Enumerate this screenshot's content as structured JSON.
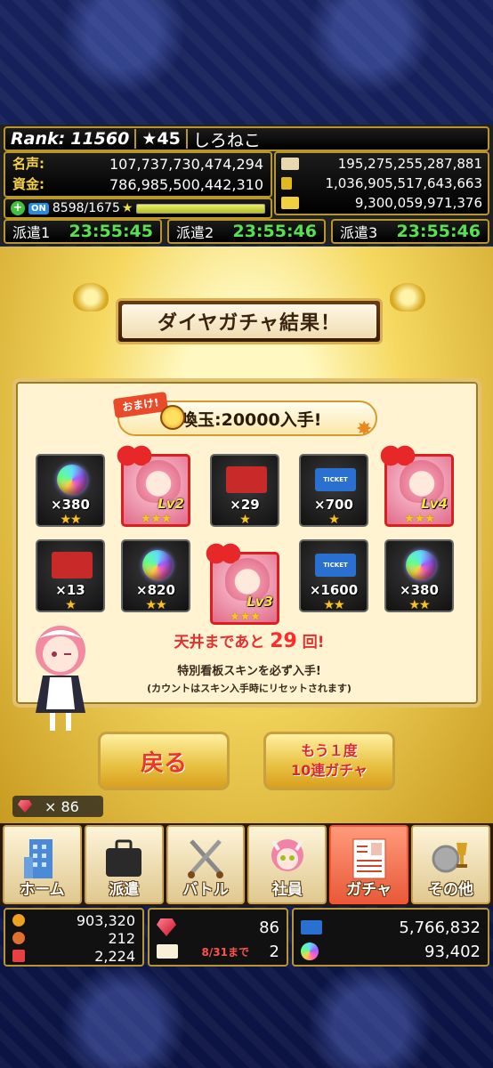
{
  "header": {
    "rank_label": "Rank:",
    "rank_value": "11560",
    "stars": "★45",
    "player_name": "しろねこ",
    "fame_label": "名声:",
    "fame_value": "107,737,730,474,294",
    "funds_label": "資金:",
    "funds_value": "786,985,500,442,310",
    "res1": "195,275,255,287,881",
    "res2": "1,036,905,517,643,663",
    "res3": "9,300,059,971,376",
    "on_label": "ON",
    "stamina": "8598/1675",
    "stamina_fill": 1.0,
    "dispatch": [
      {
        "label": "派遣1",
        "time": "23:55:45"
      },
      {
        "label": "派遣2",
        "time": "23:55:46"
      },
      {
        "label": "派遣3",
        "time": "23:55:46"
      }
    ]
  },
  "result": {
    "title": "ダイヤガチャ結果！",
    "omake_tag": "おまけ!",
    "omake_text": "召喚玉:20000入手!",
    "items": [
      {
        "type": "orb",
        "count": "×380",
        "stars": "★★"
      },
      {
        "type": "skin",
        "level": "Lv2",
        "stars": "★★★"
      },
      {
        "type": "shokan",
        "count": "×29",
        "stars": "★"
      },
      {
        "type": "ticket",
        "count": "×700",
        "stars": "★"
      },
      {
        "type": "skin",
        "level": "Lv4",
        "stars": "★★★"
      },
      {
        "type": "shokan",
        "count": "×13",
        "stars": "★"
      },
      {
        "type": "orb",
        "count": "×820",
        "stars": "★★"
      },
      {
        "type": "skin",
        "level": "Lv3",
        "stars": "★★★"
      },
      {
        "type": "ticket",
        "count": "×1600",
        "stars": "★★"
      },
      {
        "type": "orb",
        "count": "×380",
        "stars": "★★"
      }
    ],
    "ceiling_pre": "天井まであと",
    "ceiling_num": "29",
    "ceiling_post": "回!",
    "sub1": "特別看板スキンを必ず入手!",
    "sub2": "(カウントはスキン入手時にリセットされます)"
  },
  "buttons": {
    "back": "戻る",
    "again1": "もう１度",
    "again2": "10連ガチャ"
  },
  "gem_count": "× 86",
  "nav": [
    {
      "label": "ホーム",
      "icon": "building-icon"
    },
    {
      "label": "派遣",
      "icon": "briefcase-icon"
    },
    {
      "label": "バトル",
      "icon": "swords-icon"
    },
    {
      "label": "社員",
      "icon": "employee-icon"
    },
    {
      "label": "ガチャ",
      "icon": "gacha-icon",
      "active": true
    },
    {
      "label": "その他",
      "icon": "other-icon"
    }
  ],
  "bottom": {
    "l1": "903,320",
    "l2": "212",
    "l3": "2,224",
    "m1": "86",
    "m2_note": "8/31まで",
    "m2": "2",
    "r1": "5,766,832",
    "r2": "93,402"
  }
}
